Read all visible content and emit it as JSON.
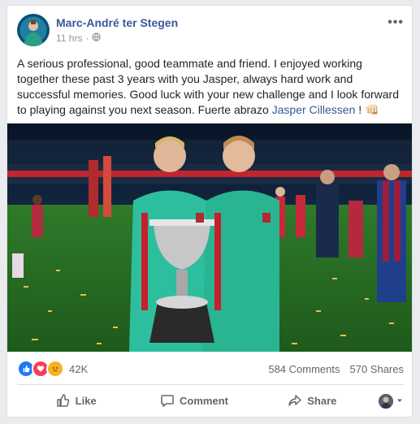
{
  "post": {
    "author": "Marc-André ter Stegen",
    "time": "11 hrs",
    "text_main": "A serious professional, good teammate and friend. I enjoyed working together these past 3 years with you Jasper, always hard work and successful memories. Good luck with your new challenge and I look forward to playing against you next season. Fuerte abrazo ",
    "tagged_name": "Jasper Cillessen",
    "text_tail": " ! 👊🏻"
  },
  "stats": {
    "reactions_count": "42K",
    "comments": "584 Comments",
    "shares": "570 Shares"
  },
  "actions": {
    "like": "Like",
    "comment": "Comment",
    "share": "Share"
  },
  "icons": {
    "privacy": "globe-icon",
    "more": "more-options-icon",
    "like": "thumbs-up-icon",
    "comment": "speech-bubble-icon",
    "share": "share-arrow-icon",
    "audience_dropdown": "caret-down-icon"
  },
  "colors": {
    "link": "#365899",
    "like_blue": "#2078f4",
    "love_red": "#f33e58",
    "sad_yellow": "#f7b125",
    "jersey_teal": "#2dbf9d"
  }
}
